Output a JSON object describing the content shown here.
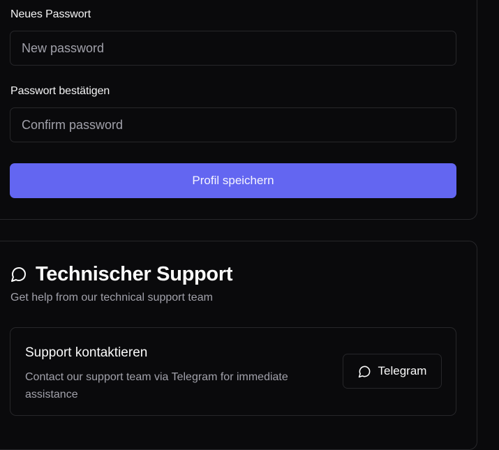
{
  "profile": {
    "new_password_label": "Neues Passwort",
    "new_password_placeholder": "New password",
    "new_password_value": "",
    "confirm_password_label": "Passwort bestätigen",
    "confirm_password_placeholder": "Confirm password",
    "confirm_password_value": "",
    "save_label": "Profil speichern"
  },
  "support": {
    "title_icon": "message-circle-icon",
    "title": "Technischer Support",
    "subtitle": "Get help from our technical support team",
    "contact": {
      "heading": "Support kontaktieren",
      "description": "Contact our support team via Telegram for immediate assistance",
      "button_icon": "message-circle-icon",
      "button_label": "Telegram"
    }
  },
  "colors": {
    "background": "#0a0a0c",
    "border": "#27272a",
    "accent": "#6366f1",
    "muted_text": "#a1a1aa"
  }
}
